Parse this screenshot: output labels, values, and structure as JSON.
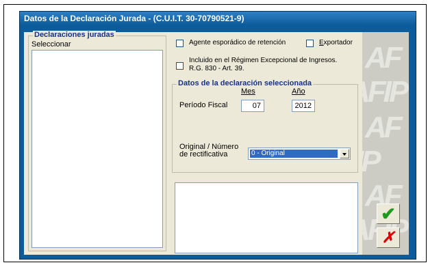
{
  "window": {
    "title": "Datos de la Declaración Jurada - (C.U.I.T. 30-70790521-9)"
  },
  "declaraciones": {
    "group_label": "Declaraciones juradas",
    "select_label": "Seleccionar",
    "items": []
  },
  "options": {
    "agente_label": "Agente esporádico de retención",
    "agente_checked": false,
    "exportador_label": "Exportador",
    "exportador_checked": false,
    "regimen_line1": "Incluido en el Régimen Excepcional de Ingresos.",
    "regimen_line2": "R.G. 830 - Art. 39.",
    "regimen_checked": false
  },
  "datos": {
    "group_label": "Datos de la declaración seleccionada",
    "periodo_label": "Período Fiscal",
    "mes_label": "Mes",
    "mes_value": "07",
    "anio_label": "Año",
    "anio_value": "2012",
    "original_label_line1": "Original / Número",
    "original_label_line2": "de rectificativa",
    "original_value": "0 - Original"
  },
  "watermark": {
    "text": "AFIP"
  },
  "colors": {
    "window_blue": "#0c5b9a",
    "dialog_bg": "#ece9d8",
    "group_title": "#15318c",
    "selection": "#316ac5",
    "ok_green": "#1e9a1e",
    "cancel_red": "#e00000"
  },
  "buttons": {
    "ok_icon": "checkmark-icon",
    "cancel_icon": "x-cancel-icon"
  }
}
